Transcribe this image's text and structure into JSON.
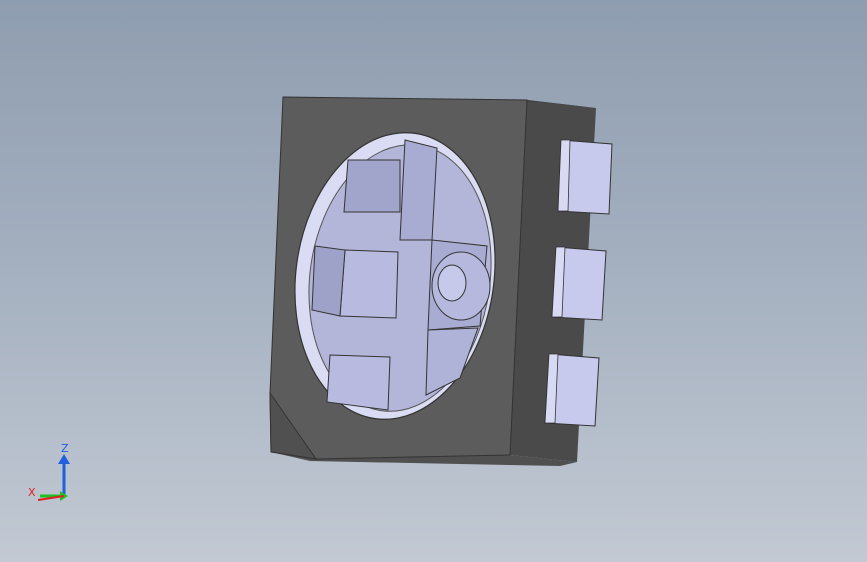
{
  "viewport": {
    "background_top": "#8f9db0",
    "background_bottom": "#c2c9d3"
  },
  "model": {
    "name": "smd-led-package",
    "body_color": "#5c5c5c",
    "body_side_color": "#4a4a4a",
    "lens_face_color": "#b3b5d9",
    "lens_edge_color": "#dadcf3",
    "pad_color": "#c3c6ea",
    "pad_count": 6,
    "visible_pads": 3
  },
  "triad": {
    "z_label": "Z",
    "x_label": "X",
    "z_color": "#1f5fe0",
    "x_color": "#e02020",
    "y_color": "#20c020"
  }
}
